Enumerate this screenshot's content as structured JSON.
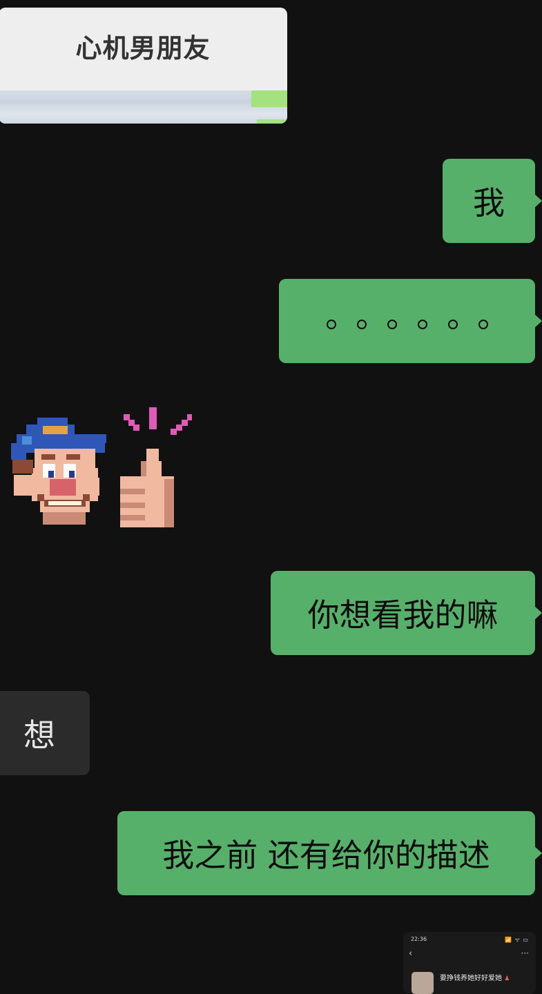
{
  "card": {
    "title": "心机男朋友"
  },
  "messages": [
    {
      "id": "m1",
      "direction": "out",
      "text": "我"
    },
    {
      "id": "m2",
      "direction": "out",
      "text": "。。。。。。"
    },
    {
      "id": "m3",
      "direction": "in",
      "sticker": "wreck-it-ralph-thumbs-up-sticker"
    },
    {
      "id": "m4",
      "direction": "out",
      "text": "你想看我的嘛"
    },
    {
      "id": "m5",
      "direction": "in",
      "text": "想"
    },
    {
      "id": "m6",
      "direction": "out",
      "text": "我之前 还有给你的描述"
    }
  ],
  "screenshot_thumb": {
    "time": "22:36",
    "status_icons": "📶 ᯤ ▭",
    "back": "‹",
    "more": "···",
    "name": "要挣钱养她好好爱她"
  },
  "colors": {
    "background": "#111111",
    "outgoing_bubble": "#57b06a",
    "incoming_bubble": "#2b2b2b"
  }
}
